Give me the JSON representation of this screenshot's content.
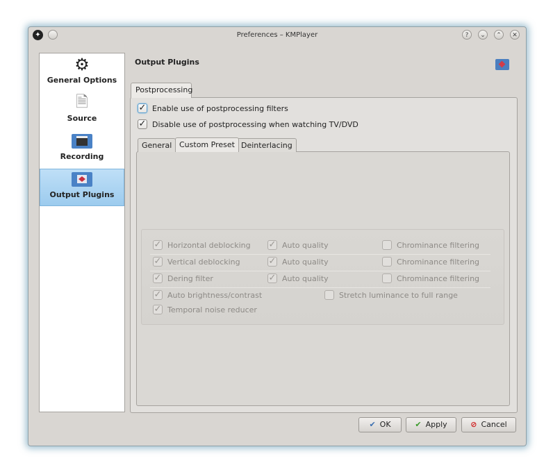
{
  "window": {
    "title": "Preferences – KMPlayer"
  },
  "sidebar": {
    "items": [
      {
        "label": "General Options",
        "icon": "film-reel-icon"
      },
      {
        "label": "Source",
        "icon": "document-icon"
      },
      {
        "label": "Recording",
        "icon": "clapperboard-folder-icon"
      },
      {
        "label": "Output Plugins",
        "icon": "video-folder-icon",
        "selected": true
      }
    ]
  },
  "page": {
    "title": "Output Plugins"
  },
  "outer_tab": "Postprocessing",
  "options": {
    "enable": "Enable use of postprocessing filters",
    "disable_tv": "Disable use of postprocessing when watching TV/DVD"
  },
  "inner_tabs": [
    "General",
    "Custom Preset",
    "Deinterlacing"
  ],
  "filters": {
    "horizontal": "Horizontal deblocking",
    "vertical": "Vertical deblocking",
    "dering": "Dering filter",
    "auto_quality": "Auto quality",
    "chrominance": "Chrominance filtering",
    "auto_brightness": "Auto brightness/contrast",
    "temporal": "Temporal noise reducer",
    "stretch": "Stretch luminance to full range"
  },
  "buttons": {
    "ok": "OK",
    "apply": "Apply",
    "cancel": "Cancel"
  },
  "colors": {
    "selection": "#9ccbee",
    "ok_icon": "#3b6fb0",
    "apply_icon": "#3a9a2a",
    "cancel_icon": "#d02020"
  }
}
